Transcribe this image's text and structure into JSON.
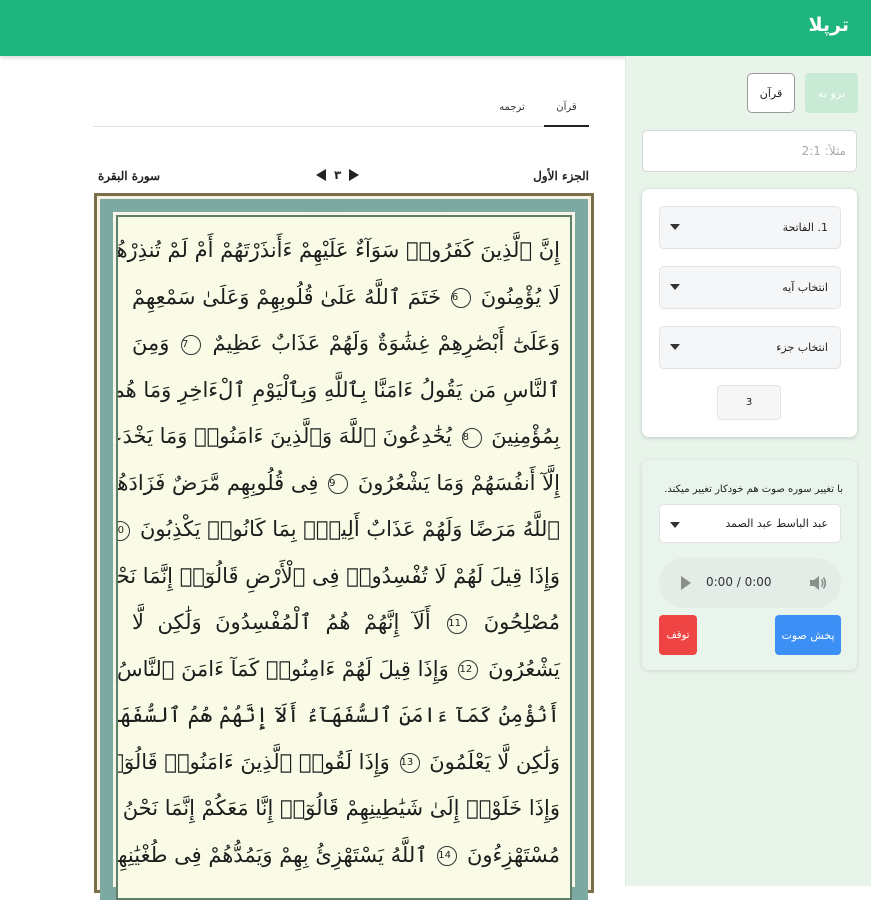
{
  "app": {
    "brand": "ترپلا"
  },
  "sidebar": {
    "go_label": "برو به",
    "quran_label": "قرآن",
    "search_placeholder": "مثلاً: 2:1",
    "surah_select": "1. الفاتحة",
    "ayah_select": "انتخاب آیه",
    "juz_select": "انتخاب جزء",
    "juz_number": "3"
  },
  "audio": {
    "hint": "با تغییر سوره صوت هم خودکار تغییر میکند.",
    "reciter": "عبد الباسط عبد الصمد",
    "time": "0:00 / 0:00",
    "play_label": "پخش صوت",
    "stop_label": "توقف"
  },
  "tabs": {
    "quran": "قرآن",
    "translation": "ترجمه"
  },
  "page": {
    "juz": "الجزء الأول",
    "surah": "سورة البقرة",
    "page_number": "٣"
  },
  "mushaf": {
    "lines": [
      "إِنَّ ٱلَّذِينَ كَفَرُوا۟ سَوَآءٌ عَلَيْهِمْ ءَأَنذَرْتَهُمْ أَمْ لَمْ تُنذِرْهُمْ",
      "لَا يُؤْمِنُونَ",
      "خَتَمَ ٱللَّهُ عَلَىٰ قُلُوبِهِمْ وَعَلَىٰ سَمْعِهِمْ",
      "وَعَلَىٰٓ أَبْصَٰرِهِمْ غِشَٰوَةٌ وَلَهُمْ عَذَابٌ عَظِيمٌ",
      "وَمِنَ",
      "ٱلنَّاسِ مَن يَقُولُ ءَامَنَّا بِٱللَّهِ وَبِٱلْيَوْمِ ٱلْءَاخِرِ وَمَا هُم",
      "بِمُؤْمِنِينَ",
      "يُخَٰدِعُونَ ٱللَّهَ وَٱلَّذِينَ ءَامَنُوا۟ وَمَا يَخْدَعُونَ",
      "إِلَّآ أَنفُسَهُمْ وَمَا يَشْعُرُونَ",
      "فِى قُلُوبِهِم مَّرَضٌ فَزَادَهُمُ",
      "ٱللَّهُ مَرَضًا وَلَهُمْ عَذَابٌ أَلِيمٌۢ بِمَا كَانُوا۟ يَكْذِبُونَ",
      "وَإِذَا قِيلَ لَهُمْ لَا تُفْسِدُوا۟ فِى ٱلْأَرْضِ قَالُوٓا۟ إِنَّمَا نَحْنُ",
      "مُصْلِحُونَ",
      "أَلَآ إِنَّهُمْ هُمُ ٱلْمُفْسِدُونَ وَلَٰكِن لَّا",
      "يَشْعُرُونَ",
      "وَإِذَا قِيلَ لَهُمْ ءَامِنُوا۟ كَمَآ ءَامَنَ ٱلنَّاسُ قَالُوٓا۟",
      "أَنُؤْمِنُ كَمَآ ءَامَنَ ٱلسُّفَهَآءُ",
      "أَلَآ إِنَّهُمْ هُمُ ٱلسُّفَهَآءُ",
      "وَلَٰكِن لَّا يَعْلَمُونَ",
      "وَإِذَا لَقُوا۟ ٱلَّذِينَ ءَامَنُوا۟ قَالُوٓا۟ ءَامَنَّا",
      "وَإِذَا خَلَوْا۟ إِلَىٰ شَيَٰطِينِهِمْ قَالُوٓا۟ إِنَّا مَعَكُمْ إِنَّمَا نَحْنُ",
      "مُسْتَهْزِءُونَ",
      "ٱللَّهُ يَسْتَهْزِئُ بِهِمْ وَيَمُدُّهُمْ فِى طُغْيَٰنِهِمْ"
    ],
    "ayah_numbers": [
      "6",
      "7",
      "8",
      "9",
      "10",
      "11",
      "12",
      "13",
      "14"
    ]
  }
}
